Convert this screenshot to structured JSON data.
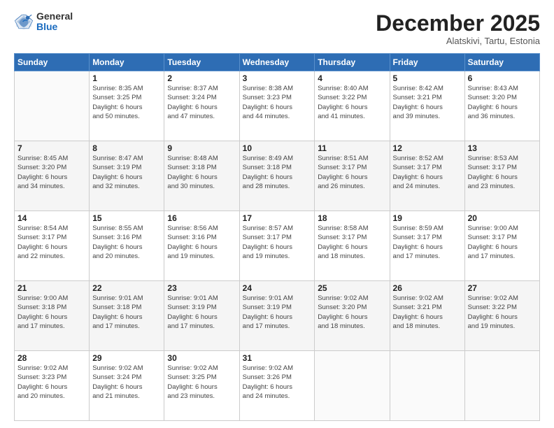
{
  "header": {
    "logo_general": "General",
    "logo_blue": "Blue",
    "month": "December 2025",
    "location": "Alatskivi, Tartu, Estonia"
  },
  "weekdays": [
    "Sunday",
    "Monday",
    "Tuesday",
    "Wednesday",
    "Thursday",
    "Friday",
    "Saturday"
  ],
  "weeks": [
    [
      {
        "day": "",
        "info": ""
      },
      {
        "day": "1",
        "info": "Sunrise: 8:35 AM\nSunset: 3:25 PM\nDaylight: 6 hours\nand 50 minutes."
      },
      {
        "day": "2",
        "info": "Sunrise: 8:37 AM\nSunset: 3:24 PM\nDaylight: 6 hours\nand 47 minutes."
      },
      {
        "day": "3",
        "info": "Sunrise: 8:38 AM\nSunset: 3:23 PM\nDaylight: 6 hours\nand 44 minutes."
      },
      {
        "day": "4",
        "info": "Sunrise: 8:40 AM\nSunset: 3:22 PM\nDaylight: 6 hours\nand 41 minutes."
      },
      {
        "day": "5",
        "info": "Sunrise: 8:42 AM\nSunset: 3:21 PM\nDaylight: 6 hours\nand 39 minutes."
      },
      {
        "day": "6",
        "info": "Sunrise: 8:43 AM\nSunset: 3:20 PM\nDaylight: 6 hours\nand 36 minutes."
      }
    ],
    [
      {
        "day": "7",
        "info": "Sunrise: 8:45 AM\nSunset: 3:20 PM\nDaylight: 6 hours\nand 34 minutes."
      },
      {
        "day": "8",
        "info": "Sunrise: 8:47 AM\nSunset: 3:19 PM\nDaylight: 6 hours\nand 32 minutes."
      },
      {
        "day": "9",
        "info": "Sunrise: 8:48 AM\nSunset: 3:18 PM\nDaylight: 6 hours\nand 30 minutes."
      },
      {
        "day": "10",
        "info": "Sunrise: 8:49 AM\nSunset: 3:18 PM\nDaylight: 6 hours\nand 28 minutes."
      },
      {
        "day": "11",
        "info": "Sunrise: 8:51 AM\nSunset: 3:17 PM\nDaylight: 6 hours\nand 26 minutes."
      },
      {
        "day": "12",
        "info": "Sunrise: 8:52 AM\nSunset: 3:17 PM\nDaylight: 6 hours\nand 24 minutes."
      },
      {
        "day": "13",
        "info": "Sunrise: 8:53 AM\nSunset: 3:17 PM\nDaylight: 6 hours\nand 23 minutes."
      }
    ],
    [
      {
        "day": "14",
        "info": "Sunrise: 8:54 AM\nSunset: 3:17 PM\nDaylight: 6 hours\nand 22 minutes."
      },
      {
        "day": "15",
        "info": "Sunrise: 8:55 AM\nSunset: 3:16 PM\nDaylight: 6 hours\nand 20 minutes."
      },
      {
        "day": "16",
        "info": "Sunrise: 8:56 AM\nSunset: 3:16 PM\nDaylight: 6 hours\nand 19 minutes."
      },
      {
        "day": "17",
        "info": "Sunrise: 8:57 AM\nSunset: 3:17 PM\nDaylight: 6 hours\nand 19 minutes."
      },
      {
        "day": "18",
        "info": "Sunrise: 8:58 AM\nSunset: 3:17 PM\nDaylight: 6 hours\nand 18 minutes."
      },
      {
        "day": "19",
        "info": "Sunrise: 8:59 AM\nSunset: 3:17 PM\nDaylight: 6 hours\nand 17 minutes."
      },
      {
        "day": "20",
        "info": "Sunrise: 9:00 AM\nSunset: 3:17 PM\nDaylight: 6 hours\nand 17 minutes."
      }
    ],
    [
      {
        "day": "21",
        "info": "Sunrise: 9:00 AM\nSunset: 3:18 PM\nDaylight: 6 hours\nand 17 minutes."
      },
      {
        "day": "22",
        "info": "Sunrise: 9:01 AM\nSunset: 3:18 PM\nDaylight: 6 hours\nand 17 minutes."
      },
      {
        "day": "23",
        "info": "Sunrise: 9:01 AM\nSunset: 3:19 PM\nDaylight: 6 hours\nand 17 minutes."
      },
      {
        "day": "24",
        "info": "Sunrise: 9:01 AM\nSunset: 3:19 PM\nDaylight: 6 hours\nand 17 minutes."
      },
      {
        "day": "25",
        "info": "Sunrise: 9:02 AM\nSunset: 3:20 PM\nDaylight: 6 hours\nand 18 minutes."
      },
      {
        "day": "26",
        "info": "Sunrise: 9:02 AM\nSunset: 3:21 PM\nDaylight: 6 hours\nand 18 minutes."
      },
      {
        "day": "27",
        "info": "Sunrise: 9:02 AM\nSunset: 3:22 PM\nDaylight: 6 hours\nand 19 minutes."
      }
    ],
    [
      {
        "day": "28",
        "info": "Sunrise: 9:02 AM\nSunset: 3:23 PM\nDaylight: 6 hours\nand 20 minutes."
      },
      {
        "day": "29",
        "info": "Sunrise: 9:02 AM\nSunset: 3:24 PM\nDaylight: 6 hours\nand 21 minutes."
      },
      {
        "day": "30",
        "info": "Sunrise: 9:02 AM\nSunset: 3:25 PM\nDaylight: 6 hours\nand 23 minutes."
      },
      {
        "day": "31",
        "info": "Sunrise: 9:02 AM\nSunset: 3:26 PM\nDaylight: 6 hours\nand 24 minutes."
      },
      {
        "day": "",
        "info": ""
      },
      {
        "day": "",
        "info": ""
      },
      {
        "day": "",
        "info": ""
      }
    ]
  ]
}
